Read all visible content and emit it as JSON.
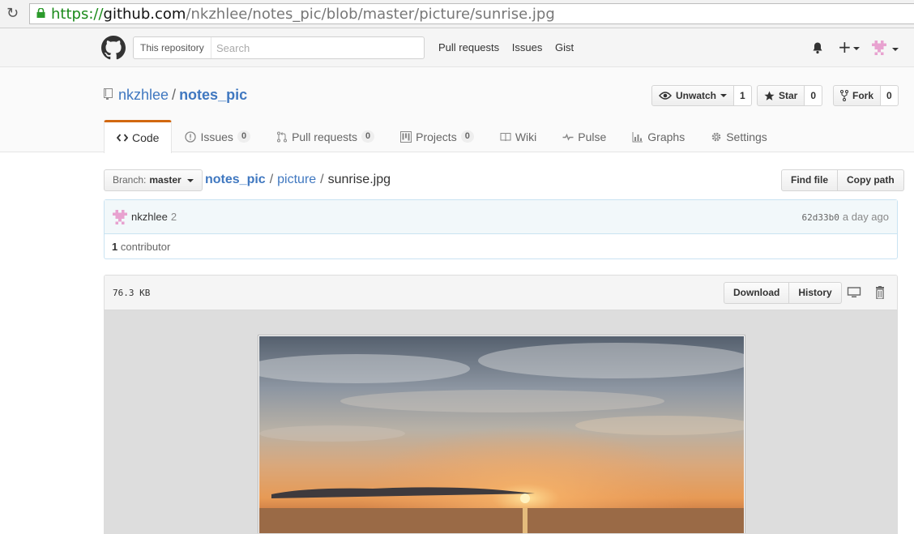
{
  "browser": {
    "url_scheme": "https://",
    "url_host": "github.com",
    "url_path": "/nkzhlee/notes_pic/blob/master/picture/sunrise.jpg"
  },
  "header": {
    "search_scope": "This repository",
    "search_placeholder": "Search",
    "nav": [
      "Pull requests",
      "Issues",
      "Gist"
    ]
  },
  "repo": {
    "owner": "nkzhlee",
    "name": "notes_pic",
    "watch_label": "Unwatch",
    "watch_count": "1",
    "star_label": "Star",
    "star_count": "0",
    "fork_label": "Fork",
    "fork_count": "0",
    "tabs": [
      {
        "label": "Code",
        "icon": "code-icon"
      },
      {
        "label": "Issues",
        "counter": "0",
        "icon": "issue-icon"
      },
      {
        "label": "Pull requests",
        "counter": "0",
        "icon": "pull-request-icon"
      },
      {
        "label": "Projects",
        "counter": "0",
        "icon": "project-icon"
      },
      {
        "label": "Wiki",
        "icon": "book-icon"
      },
      {
        "label": "Pulse",
        "icon": "pulse-icon"
      },
      {
        "label": "Graphs",
        "icon": "graph-icon"
      },
      {
        "label": "Settings",
        "icon": "gear-icon"
      }
    ]
  },
  "file_nav": {
    "branch_prefix": "Branch:",
    "branch": "master",
    "breadcrumb_root": "notes_pic",
    "breadcrumb_dir": "picture",
    "breadcrumb_file": "sunrise.jpg",
    "find_file": "Find file",
    "copy_path": "Copy path"
  },
  "commit": {
    "author": "nkzhlee",
    "count": "2",
    "sha": "62d33b0",
    "time": "a day ago",
    "contributors_count": "1",
    "contributors_label": "contributor"
  },
  "file": {
    "size": "76.3 KB",
    "download": "Download",
    "history": "History"
  },
  "colors": {
    "link": "#4078c0",
    "tab_accent": "#d26911",
    "commit_bg": "#f2f8fa"
  }
}
